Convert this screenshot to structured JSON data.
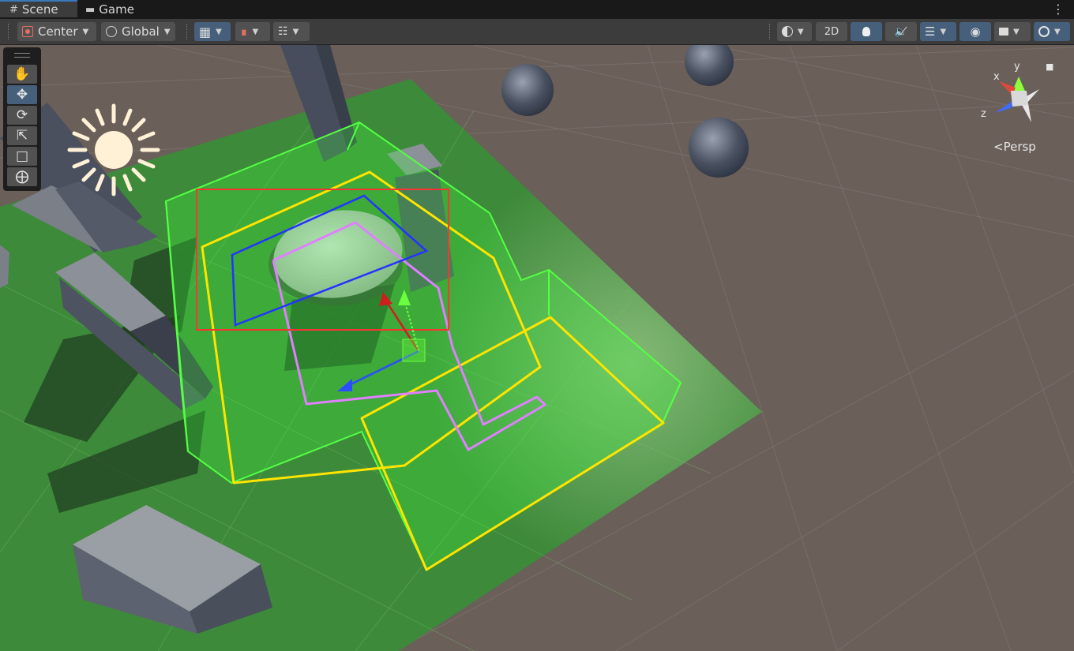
{
  "tabs": [
    {
      "label": "Scene",
      "icon": "grid-icon",
      "active": true
    },
    {
      "label": "Game",
      "icon": "gamepad-icon",
      "active": false
    }
  ],
  "toolbar": {
    "pivot_label": "Center",
    "space_label": "Global",
    "mode_2d_label": "2D"
  },
  "gizmo": {
    "x_label": "x",
    "y_label": "y",
    "z_label": "z",
    "projection_label": "Persp"
  },
  "colors": {
    "accent": "#46607c",
    "selection_outline": "#ff8a00",
    "volume_green": "#3cff3c",
    "path_yellow": "#ffe400",
    "path_violet": "#e07fff",
    "rect_blue": "#2334ff",
    "rect_red": "#ff3333"
  }
}
